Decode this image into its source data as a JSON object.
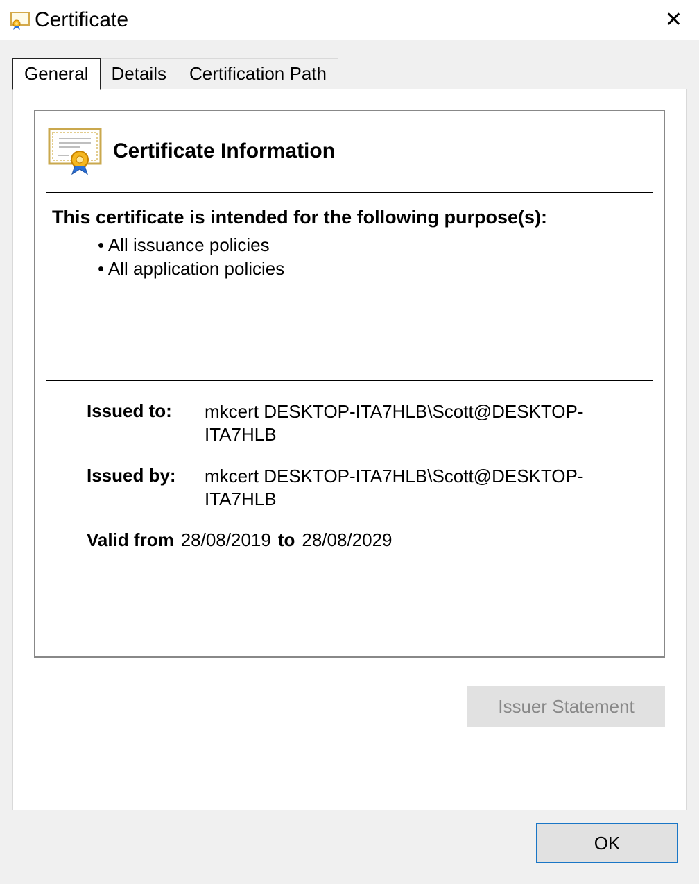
{
  "window": {
    "title": "Certificate"
  },
  "tabs": {
    "general": "General",
    "details": "Details",
    "certpath": "Certification Path"
  },
  "cert": {
    "info_title": "Certificate Information",
    "purpose_heading": "This certificate is intended for the following purpose(s):",
    "purposes": {
      "p0": "All issuance policies",
      "p1": "All application policies"
    },
    "issued_to_label": "Issued to:",
    "issued_to_value": "mkcert DESKTOP-ITA7HLB\\Scott@DESKTOP-ITA7HLB",
    "issued_by_label": "Issued by:",
    "issued_by_value": "mkcert DESKTOP-ITA7HLB\\Scott@DESKTOP-ITA7HLB",
    "valid_from_label": "Valid from",
    "valid_from_value": "28/08/2019",
    "valid_to_label": "to",
    "valid_to_value": "28/08/2029"
  },
  "buttons": {
    "issuer_statement": "Issuer Statement",
    "ok": "OK"
  }
}
